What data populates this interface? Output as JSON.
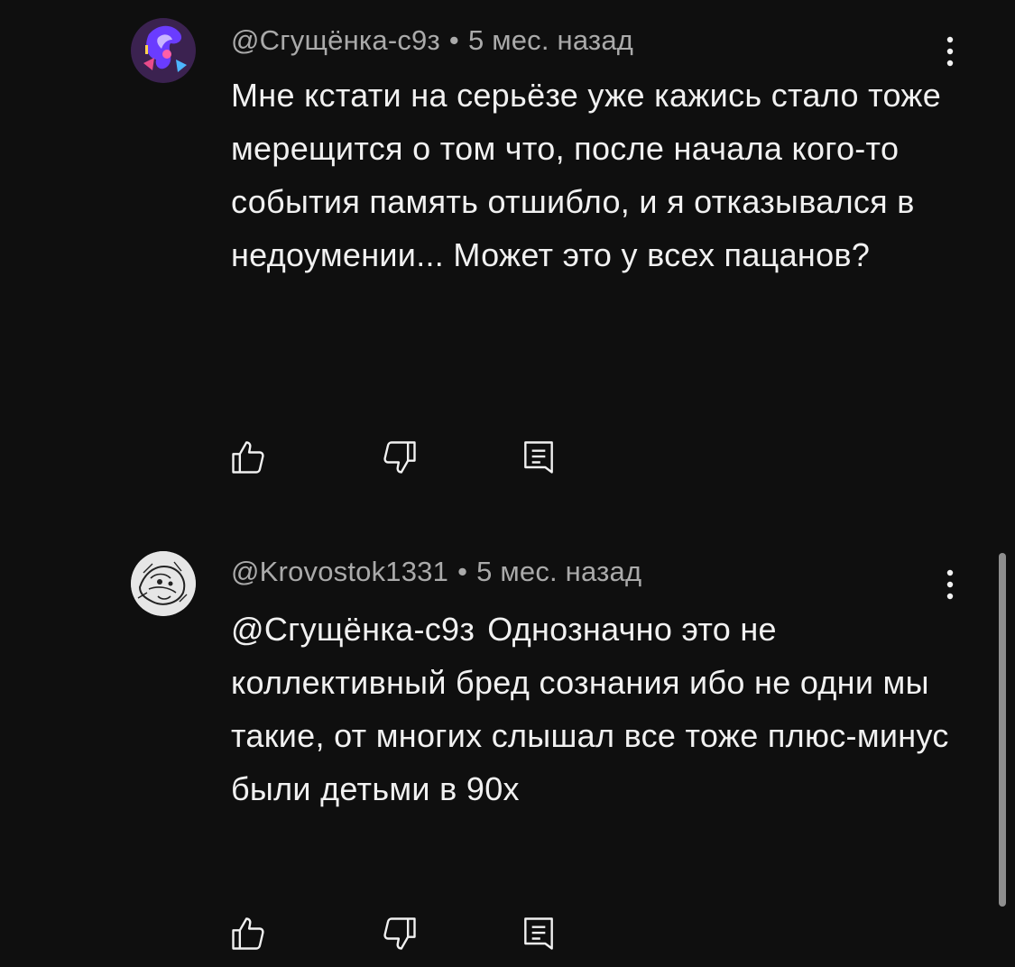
{
  "comments": [
    {
      "author": "@Сгущёнка-с9з",
      "separator": "•",
      "time": "5 мес. назад",
      "mention": "",
      "text": "Мне кстати на серьёзе уже кажись стало тоже мерещится о том что, после начала кого-то события память отшибло, и я отказывался в недоумении... Может это у всех пацанов?",
      "avatar_icon": "anime-character-avatar",
      "colors": {
        "avatar_bg": "#2a1a3a",
        "avatar_accent": "#7a4cff"
      }
    },
    {
      "author": "@Krovostok1331",
      "separator": "•",
      "time": "5 мес. назад",
      "mention": "@Сгущёнка-с9з",
      "text": "Однозначно это не коллективный бред сознания ибо не одни мы такие, от многих слышал все тоже плюс-минус были детьми в 90х",
      "avatar_icon": "sketch-drawing-avatar",
      "colors": {
        "avatar_bg": "#d8d8d8",
        "avatar_accent": "#222222"
      }
    }
  ],
  "icons": {
    "like": "thumbs-up-icon",
    "dislike": "thumbs-down-icon",
    "reply": "reply-comment-icon",
    "more": "vertical-dots-icon"
  },
  "colors": {
    "background": "#0f0f0f",
    "text": "#f1f1f1",
    "meta": "#aaaaaa",
    "scrollbar": "#8e8e8e"
  }
}
